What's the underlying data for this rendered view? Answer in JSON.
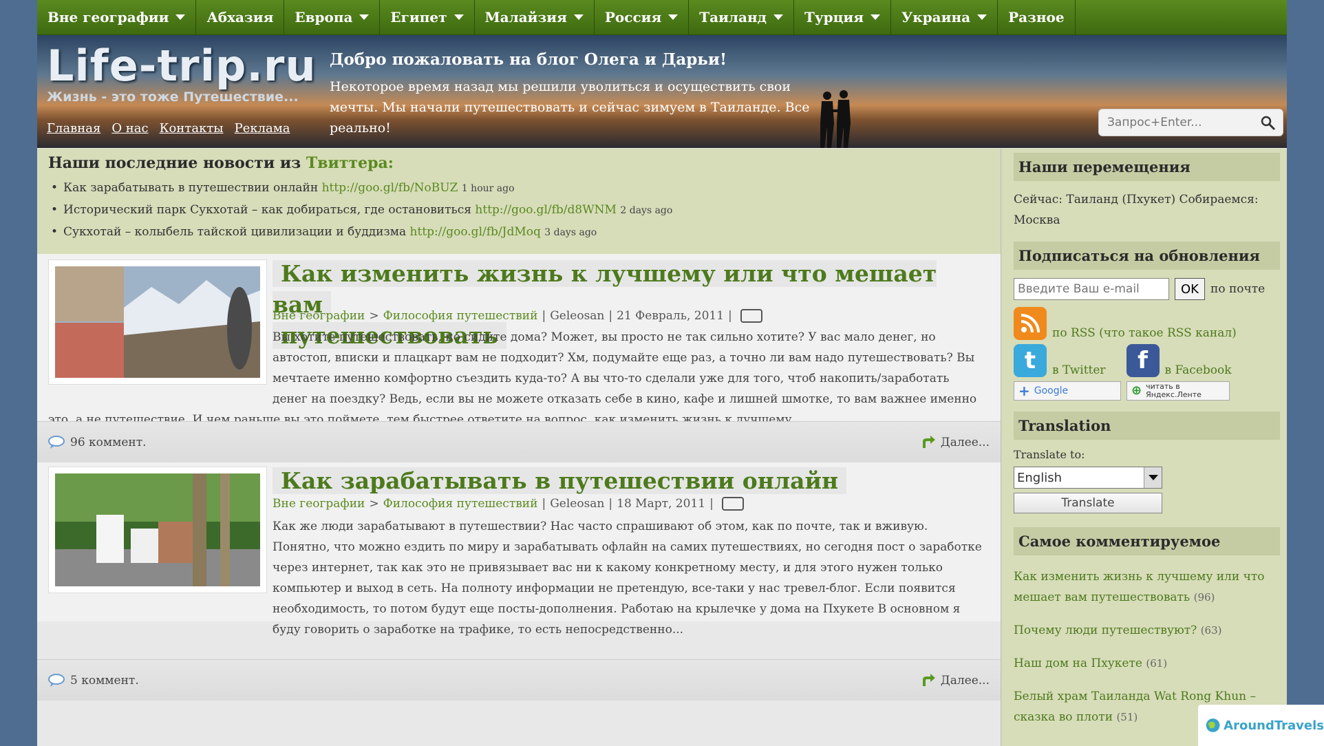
{
  "nav": [
    {
      "label": "Вне географии",
      "dropdown": true
    },
    {
      "label": "Абхазия",
      "dropdown": false
    },
    {
      "label": "Европа",
      "dropdown": true
    },
    {
      "label": "Египет",
      "dropdown": true
    },
    {
      "label": "Малайзия",
      "dropdown": true
    },
    {
      "label": "Россия",
      "dropdown": true
    },
    {
      "label": "Таиланд",
      "dropdown": true
    },
    {
      "label": "Турция",
      "dropdown": true
    },
    {
      "label": "Украина",
      "dropdown": true
    },
    {
      "label": "Разное",
      "dropdown": false
    }
  ],
  "header": {
    "logo_title": "Life-trip.ru",
    "logo_subtitle": "Жизнь - это тоже Путешествие...",
    "links": [
      "Главная",
      "О нас",
      "Контакты",
      "Реклама"
    ],
    "welcome_title": "Добро пожаловать на блог Олега и Дарьи!",
    "welcome_text": "Некоторое время назад мы решили уволиться и осуществить свои мечты. Мы начали путешествовать и сейчас зимуем в Таиланде. Все реально!",
    "search_placeholder": "Запрос+Enter..."
  },
  "twitter": {
    "heading_prefix": "Наши последние новости из ",
    "heading_link": "Твиттера:",
    "items": [
      {
        "text": "Как зарабатывать в путешествии онлайн ",
        "link": "http://goo.gl/fb/NoBUZ",
        "ago": "1 hour ago"
      },
      {
        "text": "Исторический парк Сукхотай – как добираться, где остановиться ",
        "link": "http://goo.gl/fb/d8WNM",
        "ago": "2 days ago"
      },
      {
        "text": "Сукхотай – колыбель тайской цивилизации и буддизма ",
        "link": "http://goo.gl/fb/JdMoq",
        "ago": "3 days ago"
      }
    ]
  },
  "posts": [
    {
      "title_line1": "Как изменить жизнь к лучшему или что мешает вам",
      "title_line2": "путешествовать",
      "category": "Вне географии",
      "subcategory": "Философия путешествий",
      "author": "Geleosan",
      "date": "21 Февраль, 2011",
      "excerpt_lines": [
        "Вы хотите путешествовать, но сидите дома? Может, вы просто не так сильно хотите? У вас мало денег, но",
        "автостоп, вписки и плацкарт вам не подходит? Хм, подумайте еще раз, а точно ли вам надо путешествовать? Вы",
        "мечтаете именно комфортно съездить куда-то? А вы что-то сделали уже для того, чтоб накопить/заработать",
        "денег на поездку? Ведь, если вы не можете отказать себе в кино, кафе и лишней шмотке, то вам важнее именно"
      ],
      "excerpt_last": "это, а не путешествие. И чем раньше вы это поймете, тем быстрее ответите на вопрос, как изменить жизнь к лучшему",
      "comments": "96 коммент.",
      "more": "Далее..."
    },
    {
      "title_line1": "Как зарабатывать в путешествии онлайн",
      "category": "Вне географии",
      "subcategory": "Философия путешествий",
      "author": "Geleosan",
      "date": "18 Март, 2011",
      "excerpt_lines": [
        "Как же люди зарабатывают в путешествии? Нас часто спрашивают об этом, как по почте, так и вживую.",
        "Понятно, что можно ездить по миру и зарабатывать офлайн на самих путешествиях, но сегодня пост о заработке",
        "через интернет, так как это не привязывает вас ни к какому конкретному месту, и для этого нужен только",
        "компьютер и выход в сеть. На полноту информации не претендую, все-таки у нас тревел-блог. Если появится",
        "необходимость, то потом будут еще посты-дополнения. Работаю на крылечке у дома на Пхукете В основном я",
        "буду говорить о заработке на трафике, то есть непосредственно..."
      ],
      "comments": "5 коммент.",
      "more": "Далее..."
    }
  ],
  "sidebar": {
    "moves_heading": "Наши перемещения",
    "moves_text": "Сейчас: Таиланд (Пхукет) Собираемся: Москва",
    "subscribe_heading": "Подписаться на обновления",
    "email_placeholder": "Введите Ваш e-mail",
    "ok_label": "OK",
    "by_mail": "по почте",
    "rss_prefix": "по RSS",
    "rss_link": "(что такое RSS канал)",
    "twitter_label": "в Twitter",
    "facebook_label": "в Facebook",
    "google_label": "Google",
    "yandex_label": "читать в Яндекс.Ленте",
    "translation_heading": "Translation",
    "translate_to": "Translate to:",
    "language": "English",
    "translate_button": "Translate",
    "popular_heading": "Самое комментируемое",
    "popular": [
      {
        "title": "Как изменить жизнь к лучшему или что мешает вам путешествовать",
        "count": "(96)"
      },
      {
        "title": "Почему люди путешествуют?",
        "count": "(63)"
      },
      {
        "title": "Наш дом на Пхукете",
        "count": "(61)"
      },
      {
        "title": "Белый храм Таиланда Wat Rong Khun – сказка во плоти",
        "count": "(51)"
      }
    ]
  },
  "watermark": "AroundTravels",
  "colors": {
    "accent_green": "#5a8a1f",
    "sidebar_bg": "#d7dcb9",
    "outer_bg": "#4f6d91"
  }
}
